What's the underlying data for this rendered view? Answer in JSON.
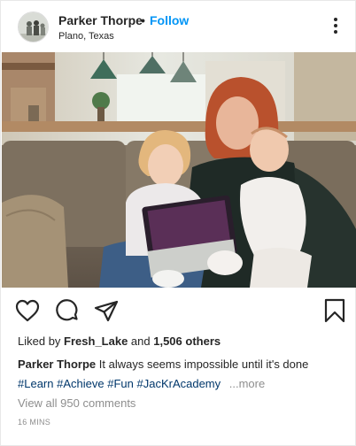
{
  "post": {
    "username": "Parker Thorpe",
    "separator": "•",
    "follow_label": "Follow",
    "location": "Plano, Texas",
    "more_icon": "more-vertical-icon",
    "photo_alt": "Woman with a toddler and a baby looking at a tablet on a sofa"
  },
  "actions": {
    "like_icon": "heart-icon",
    "comment_icon": "comment-icon",
    "share_icon": "paper-plane-icon",
    "save_icon": "bookmark-icon"
  },
  "likes": {
    "prefix": "Liked by ",
    "user": "Fresh_Lake",
    "middle": " and ",
    "count": "1,506 others"
  },
  "caption": {
    "username": "Parker Thorpe",
    "text": " It always seems impossible until it's done",
    "hashtags": [
      "#Learn",
      "#Achieve",
      "#Fun",
      "#JacKrAcademy"
    ],
    "more_label": "...more"
  },
  "comments": {
    "view_all": "View all 950 comments"
  },
  "timestamp": "16 MINS",
  "colors": {
    "follow": "#0095f6",
    "hashtag": "#00376b",
    "muted": "#8e8e8e",
    "text": "#262626"
  }
}
